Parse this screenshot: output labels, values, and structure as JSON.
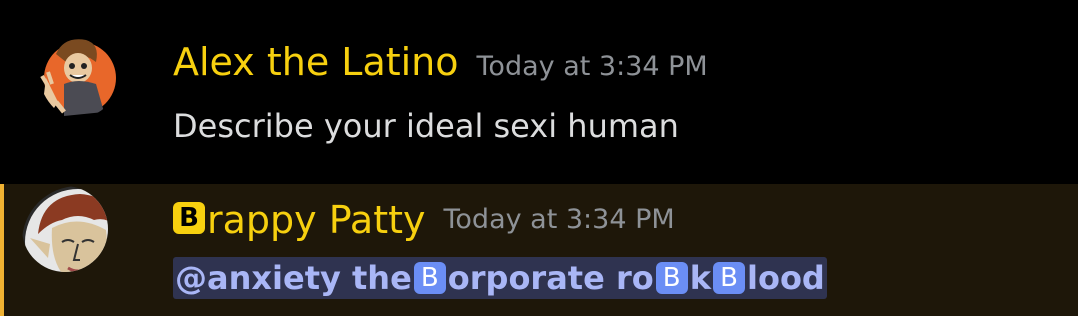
{
  "messages": [
    {
      "username": "Alex the Latino",
      "timestamp": "Today at 3:34 PM",
      "content": "Describe your ideal sexi human",
      "username_color": "#f7d00f",
      "avatar_icon": "cartoon-guy-avatar-icon"
    },
    {
      "username_emoji": "B",
      "username_rest": "rappy Patty",
      "timestamp": "Today at 3:34 PM",
      "mention_part1": "@anxiety the ",
      "emoji1": "B",
      "mention_part2": "orporate ro",
      "emoji2": "B",
      "mention_part3": "k ",
      "emoji3": "B",
      "mention_part4": "lood",
      "username_color": "#f7d00f",
      "mention_color": "#a9b6f6",
      "highlight_color": "#1e1709",
      "avatar_icon": "cartoon-elf-avatar-icon"
    }
  ]
}
